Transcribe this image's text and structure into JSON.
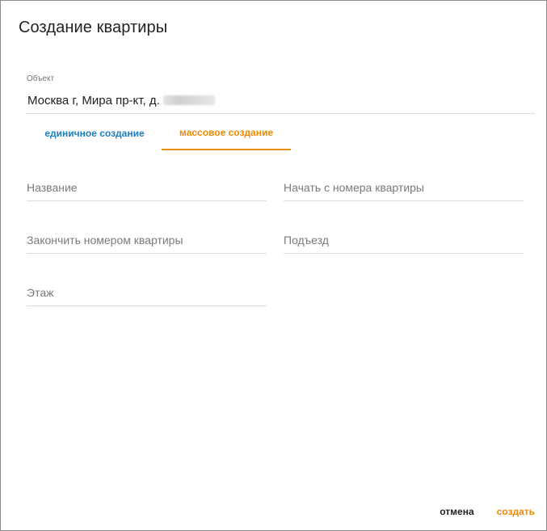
{
  "dialog": {
    "title": "Создание квартиры"
  },
  "object": {
    "label": "Объект",
    "value": "Москва г, Мира пр-кт, д."
  },
  "tabs": [
    {
      "label": "единичное создание",
      "active": false
    },
    {
      "label": "массовое создание",
      "active": true
    }
  ],
  "fields": {
    "name": {
      "placeholder": "Название"
    },
    "start_number": {
      "placeholder": "Начать с номера квартиры"
    },
    "end_number": {
      "placeholder": "Закончить номером квартиры"
    },
    "entrance": {
      "placeholder": "Подъезд"
    },
    "floor": {
      "placeholder": "Этаж"
    }
  },
  "actions": {
    "cancel_label": "отмена",
    "create_label": "создать"
  },
  "colors": {
    "accent": "#f08a00",
    "link": "#1a7ec2",
    "divider": "#dcdcdc"
  }
}
